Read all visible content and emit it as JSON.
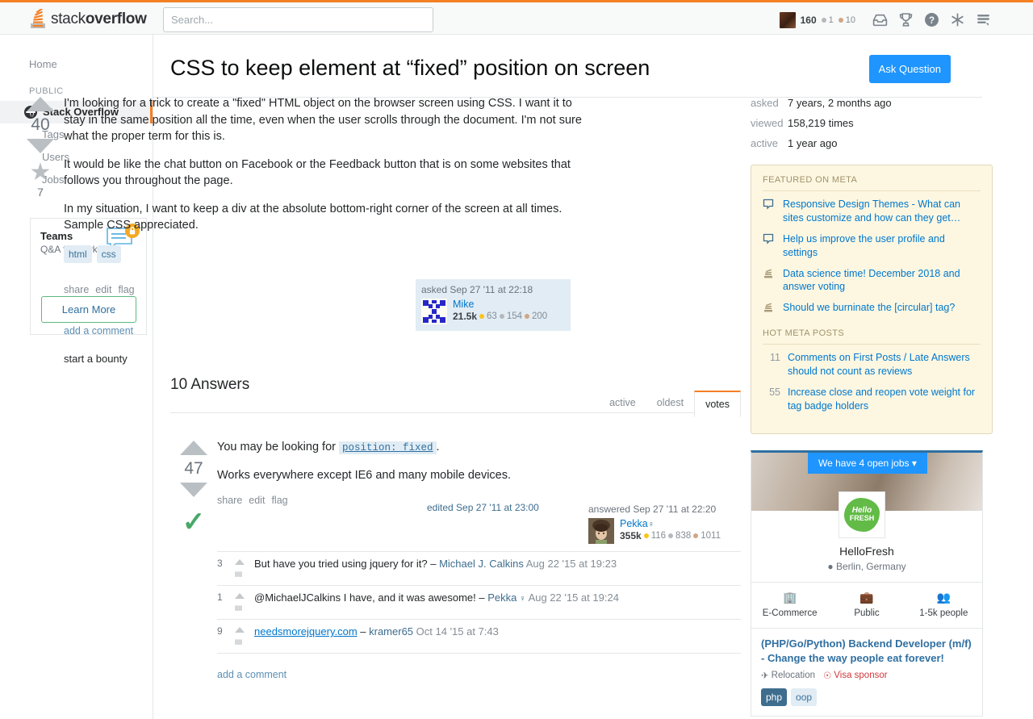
{
  "topbar": {
    "logo_text_light": "stack",
    "logo_text_bold": "overflow",
    "search_placeholder": "Search...",
    "reputation": "160",
    "silver_badges": "1",
    "bronze_badges": "10",
    "icons": [
      "inbox-icon",
      "trophy-icon",
      "help-icon",
      "site-switcher-icon",
      "chat-icon"
    ]
  },
  "leftnav": {
    "home": "Home",
    "section_public": "PUBLIC",
    "current": "Stack Overflow",
    "items": [
      "Tags",
      "Users",
      "Jobs"
    ],
    "teams": {
      "title": "Teams",
      "subtitle": "Q&A for work",
      "button": "Learn More"
    }
  },
  "question": {
    "title": "CSS to keep element at “fixed” position on screen",
    "ask_button": "Ask Question",
    "votes": "40",
    "bounty_star": "7",
    "paragraphs": [
      "I'm looking for a trick to create a \"fixed\" HTML object on the browser screen using CSS. I want it to stay in the same position all the time, even when the user scrolls through the document. I'm not sure what the proper term for this is.",
      "It would be like the chat button on Facebook or the Feedback button that is on some websites that follows you throughout the page.",
      "In my situation, I want to keep a div at the absolute bottom-right corner of the screen at all times. Sample CSS appreciated."
    ],
    "tags": [
      "html",
      "css"
    ],
    "menu": [
      "share",
      "edit",
      "flag"
    ],
    "add_comment": "add a comment",
    "start_bounty": "start a bounty",
    "signature": {
      "action": "asked Sep 27 '11 at 22:18",
      "name": "Mike",
      "rep": "21.5k",
      "gold": "63",
      "silver": "154",
      "bronze": "200"
    }
  },
  "answers_section": {
    "heading": "10 Answers",
    "tabs": [
      {
        "label": "active",
        "active": false
      },
      {
        "label": "oldest",
        "active": false
      },
      {
        "label": "votes",
        "active": true
      }
    ]
  },
  "answer": {
    "votes": "47",
    "accepted": true,
    "line1_prefix": "You may be looking for",
    "line1_code": "position: fixed",
    "line1_suffix": ".",
    "line2": "Works everywhere except IE6 and many mobile devices.",
    "menu": [
      "share",
      "edit",
      "flag"
    ],
    "edited": "edited Sep 27 '11 at 23:00",
    "signature": {
      "action": "answered Sep 27 '11 at 22:20",
      "name": "Pekka",
      "flair": "♀",
      "rep": "355k",
      "gold": "116",
      "silver": "838",
      "bronze": "1011"
    },
    "comments": [
      {
        "score": "3",
        "text": "But have you tried using jquery for it? – ",
        "user": "Michael J. Calkins",
        "flair": "",
        "date": " Aug 22 '15 at 19:23",
        "link": ""
      },
      {
        "score": "1",
        "text": "@MichaelJCalkins I have, and it was awesome! – ",
        "user": "Pekka",
        "flair": " ♀",
        "date": " Aug 22 '15 at 19:24",
        "link": ""
      },
      {
        "score": "9",
        "text": " – ",
        "user": "kramer65",
        "flair": "",
        "date": " Oct 14 '15 at 7:43",
        "link": "needsmorejquery.com"
      }
    ],
    "add_comment": "add a comment"
  },
  "sidebar": {
    "stats": [
      {
        "label": "asked",
        "value": "7 years, 2 months ago"
      },
      {
        "label": "viewed",
        "value": "158,219 times"
      },
      {
        "label": "active",
        "value": "1 year ago"
      }
    ],
    "featured_title": "FEATURED ON META",
    "featured": [
      {
        "icon": "meta-chat-icon",
        "text": "Responsive Design Themes - What can sites customize and how can they get…"
      },
      {
        "icon": "meta-chat-icon",
        "text": "Help us improve the user profile and settings"
      },
      {
        "icon": "stack-icon",
        "text": "Data science time! December 2018 and answer voting"
      },
      {
        "icon": "stack-icon",
        "text": "Should we burninate the [circular] tag?"
      }
    ],
    "hot_title": "HOT META POSTS",
    "hot_posts": [
      {
        "votes": "11",
        "text": "Comments on First Posts / Late Answers should not count as reviews"
      },
      {
        "votes": "55",
        "text": "Increase close and reopen vote weight for tag badge holders"
      }
    ],
    "job": {
      "open_jobs": "We have 4 open jobs ▾",
      "logo_top": "Hello",
      "logo_bottom": "FRESH",
      "company": "HelloFresh",
      "location": "Berlin, Germany",
      "facts": [
        {
          "icon": "building-icon",
          "label": "E-Commerce"
        },
        {
          "icon": "briefcase-icon",
          "label": "Public"
        },
        {
          "icon": "people-icon",
          "label": "1-5k people"
        }
      ],
      "title": "(PHP/Go/Python) Backend Developer (m/f) - Change the way people eat forever!",
      "perk_relocation": "Relocation",
      "perk_visa": "Visa sponsor",
      "tags": [
        {
          "label": "php",
          "dark": true
        },
        {
          "label": "oop",
          "dark": false
        }
      ]
    }
  },
  "colors": {
    "accent_orange": "#f48024",
    "link_blue": "#0077cc",
    "button_blue": "#1e95ff",
    "accept_green": "#48a868",
    "tag_bg": "#e1ecf4",
    "meta_bg": "#fdf7e2"
  }
}
